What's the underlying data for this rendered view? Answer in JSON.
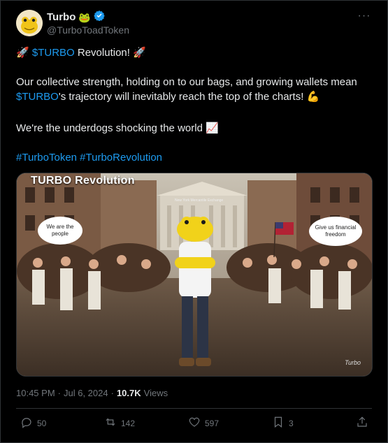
{
  "author": {
    "display_name": "Turbo",
    "name_emoji": "🐸",
    "handle": "@TurboToadToken",
    "verified": true
  },
  "more_icon": "more-horizontal-icon",
  "tweet": {
    "line1_emoji_left": "🚀",
    "line1_cashtag": "$TURBO",
    "line1_text": " Revolution! ",
    "line1_emoji_right": "🚀",
    "para2_text": "Our collective strength, holding on to our bags, and growing wallets mean ",
    "para2_cashtag": "$TURBO",
    "para2_text_end": "'s trajectory will inevitably reach the top of the charts! ",
    "para2_emoji": "💪",
    "para3_text": "We're the underdogs shocking the world ",
    "para3_emoji": "📈",
    "hashtag1": "#TurboToken",
    "hashtag2": "#TurboRevolution"
  },
  "media": {
    "title": "TURBO Revolution",
    "building_sign": "New York Mercantile Exchange",
    "bubble_left": "We are the people",
    "bubble_right": "Give us financial freedom",
    "signature": "Turbo"
  },
  "meta": {
    "time": "10:45 PM",
    "sep1": "·",
    "date": "Jul 6, 2024",
    "sep2": "·",
    "views_count": "10.7K",
    "views_label": "Views"
  },
  "actions": {
    "replies": "50",
    "reposts": "142",
    "likes": "597",
    "bookmarks": "3"
  },
  "colors": {
    "background": "#000000",
    "text": "#e7e9ea",
    "muted": "#71767b",
    "link": "#1d9bf0",
    "verified": "#1d9bf0"
  }
}
